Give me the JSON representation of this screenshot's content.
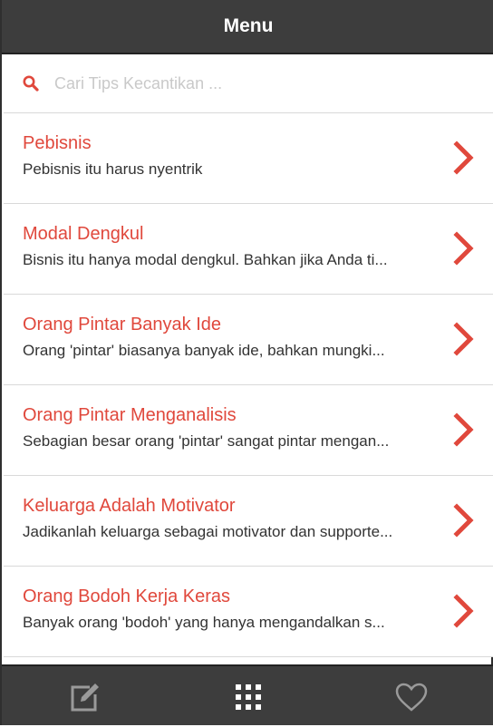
{
  "header": {
    "title": "Menu"
  },
  "search": {
    "placeholder": "Cari Tips Kecantikan ...",
    "icon": "search-icon"
  },
  "colors": {
    "accent": "#e0483c",
    "header_bg": "#3d3d3d",
    "footer_icon": "#9a9a9a"
  },
  "items": [
    {
      "title": "Pebisnis",
      "description": "Pebisnis itu harus nyentrik"
    },
    {
      "title": "Modal Dengkul",
      "description": "Bisnis itu hanya modal dengkul. Bahkan jika Anda ti..."
    },
    {
      "title": "Orang Pintar Banyak Ide",
      "description": "Orang 'pintar' biasanya banyak ide, bahkan mungki..."
    },
    {
      "title": "Orang Pintar Menganalisis",
      "description": "Sebagian besar orang 'pintar' sangat pintar mengan..."
    },
    {
      "title": "Keluarga Adalah Motivator",
      "description": "Jadikanlah keluarga sebagai motivator dan supporte..."
    },
    {
      "title": "Orang Bodoh Kerja Keras",
      "description": "Banyak orang 'bodoh' yang hanya mengandalkan s..."
    }
  ],
  "footer": {
    "tabs": [
      {
        "icon": "edit-icon"
      },
      {
        "icon": "grid-icon"
      },
      {
        "icon": "heart-icon"
      }
    ]
  }
}
